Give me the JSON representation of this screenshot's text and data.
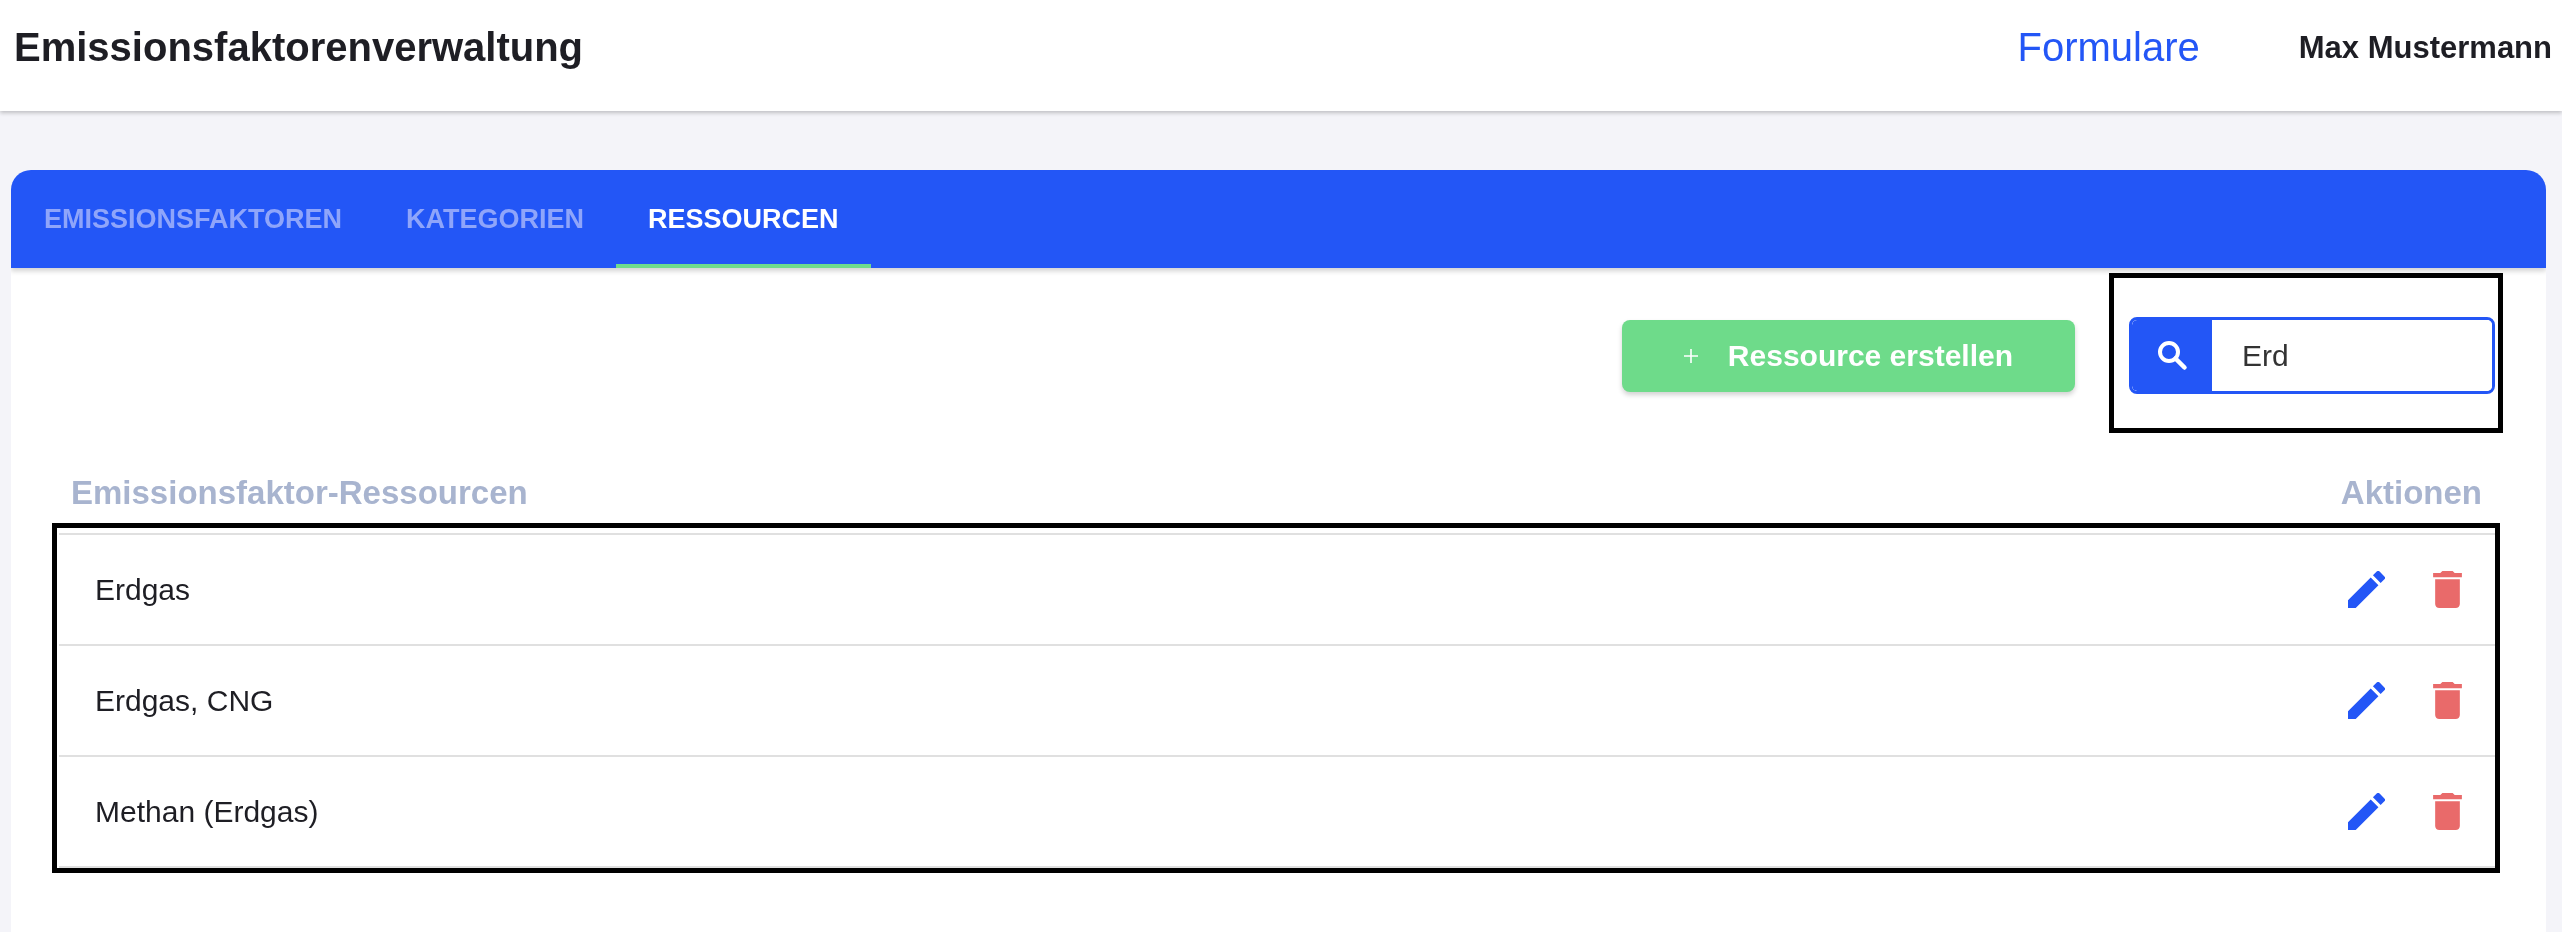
{
  "header": {
    "title": "Emissionsfaktorenverwaltung",
    "nav_link": "Formulare",
    "user_name": "Max Mustermann"
  },
  "tabs": [
    {
      "label": "EMISSIONSFAKTOREN",
      "selected": false
    },
    {
      "label": "KATEGORIEN",
      "selected": false
    },
    {
      "label": "RESSOURCEN",
      "selected": true
    }
  ],
  "toolbar": {
    "create_button": {
      "label": "Ressource erstellen"
    },
    "search": {
      "value": "Erd"
    }
  },
  "table": {
    "columns": [
      "Emissionsfaktor-Ressourcen",
      "Aktionen"
    ],
    "rows": [
      {
        "name": "Erdgas"
      },
      {
        "name": "Erdgas, CNG"
      },
      {
        "name": "Methan (Erdgas)"
      }
    ]
  }
}
